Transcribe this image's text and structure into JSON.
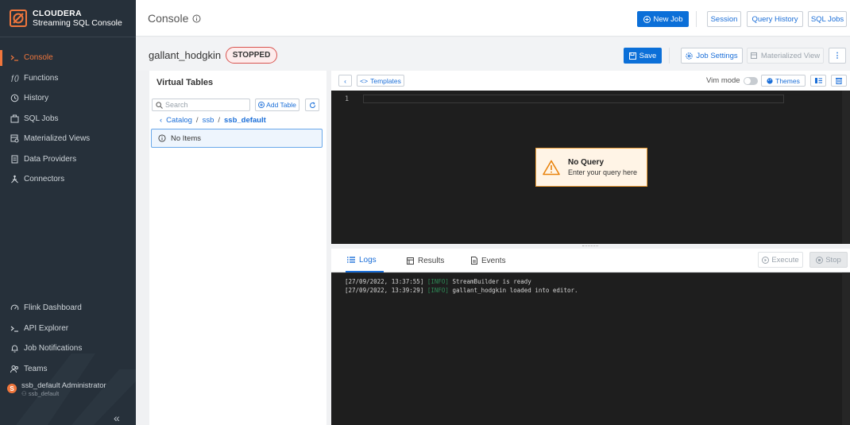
{
  "brand": {
    "line1": "CLOUDERA",
    "line2": "Streaming SQL Console"
  },
  "sidebar": {
    "items": [
      {
        "label": "Console",
        "icon": "terminal-icon",
        "active": true
      },
      {
        "label": "Functions",
        "icon": "function-icon"
      },
      {
        "label": "History",
        "icon": "history-icon"
      },
      {
        "label": "SQL Jobs",
        "icon": "jobs-icon"
      },
      {
        "label": "Materialized Views",
        "icon": "materialized-view-icon"
      },
      {
        "label": "Data Providers",
        "icon": "data-providers-icon"
      },
      {
        "label": "Connectors",
        "icon": "connectors-icon"
      }
    ],
    "bottom_items": [
      {
        "label": "Flink Dashboard",
        "icon": "dashboard-icon"
      },
      {
        "label": "API Explorer",
        "icon": "terminal-icon"
      },
      {
        "label": "Job Notifications",
        "icon": "bell-icon"
      },
      {
        "label": "Teams",
        "icon": "teams-icon"
      }
    ],
    "user": {
      "initial": "S",
      "name": "ssb_default Administrator",
      "team": "ssb_default"
    }
  },
  "header": {
    "title": "Console",
    "new_job": "New Job",
    "session": "Session",
    "query_history": "Query History",
    "sql_jobs": "SQL Jobs"
  },
  "job": {
    "name": "gallant_hodgkin",
    "status": "STOPPED",
    "save": "Save",
    "job_settings": "Job Settings",
    "materialized_view": "Materialized View"
  },
  "virtual_tables": {
    "title": "Virtual Tables",
    "search_placeholder": "Search",
    "add_table": "Add Table",
    "breadcrumb": {
      "root": "Catalog",
      "catalog": "ssb",
      "database": "ssb_default"
    },
    "empty": "No Items"
  },
  "editor": {
    "templates": "Templates",
    "vim_mode": "Vim mode",
    "themes": "Themes",
    "line_number": "1",
    "empty_title": "No Query",
    "empty_subtitle": "Enter your query here"
  },
  "output": {
    "tabs": {
      "logs": "Logs",
      "results": "Results",
      "events": "Events"
    },
    "execute": "Execute",
    "stop": "Stop",
    "logs": [
      {
        "time": "[27/09/2022, 13:37:55]",
        "level": "[INFO]",
        "message": "StreamBuilder is ready"
      },
      {
        "time": "[27/09/2022, 13:39:29]",
        "level": "[INFO]",
        "message": "gallant_hodgkin loaded into editor."
      }
    ]
  },
  "colors": {
    "accent": "#f0763c",
    "primary": "#0b6fd8",
    "sidebar": "#26303a",
    "stopped": "#d9534f"
  }
}
